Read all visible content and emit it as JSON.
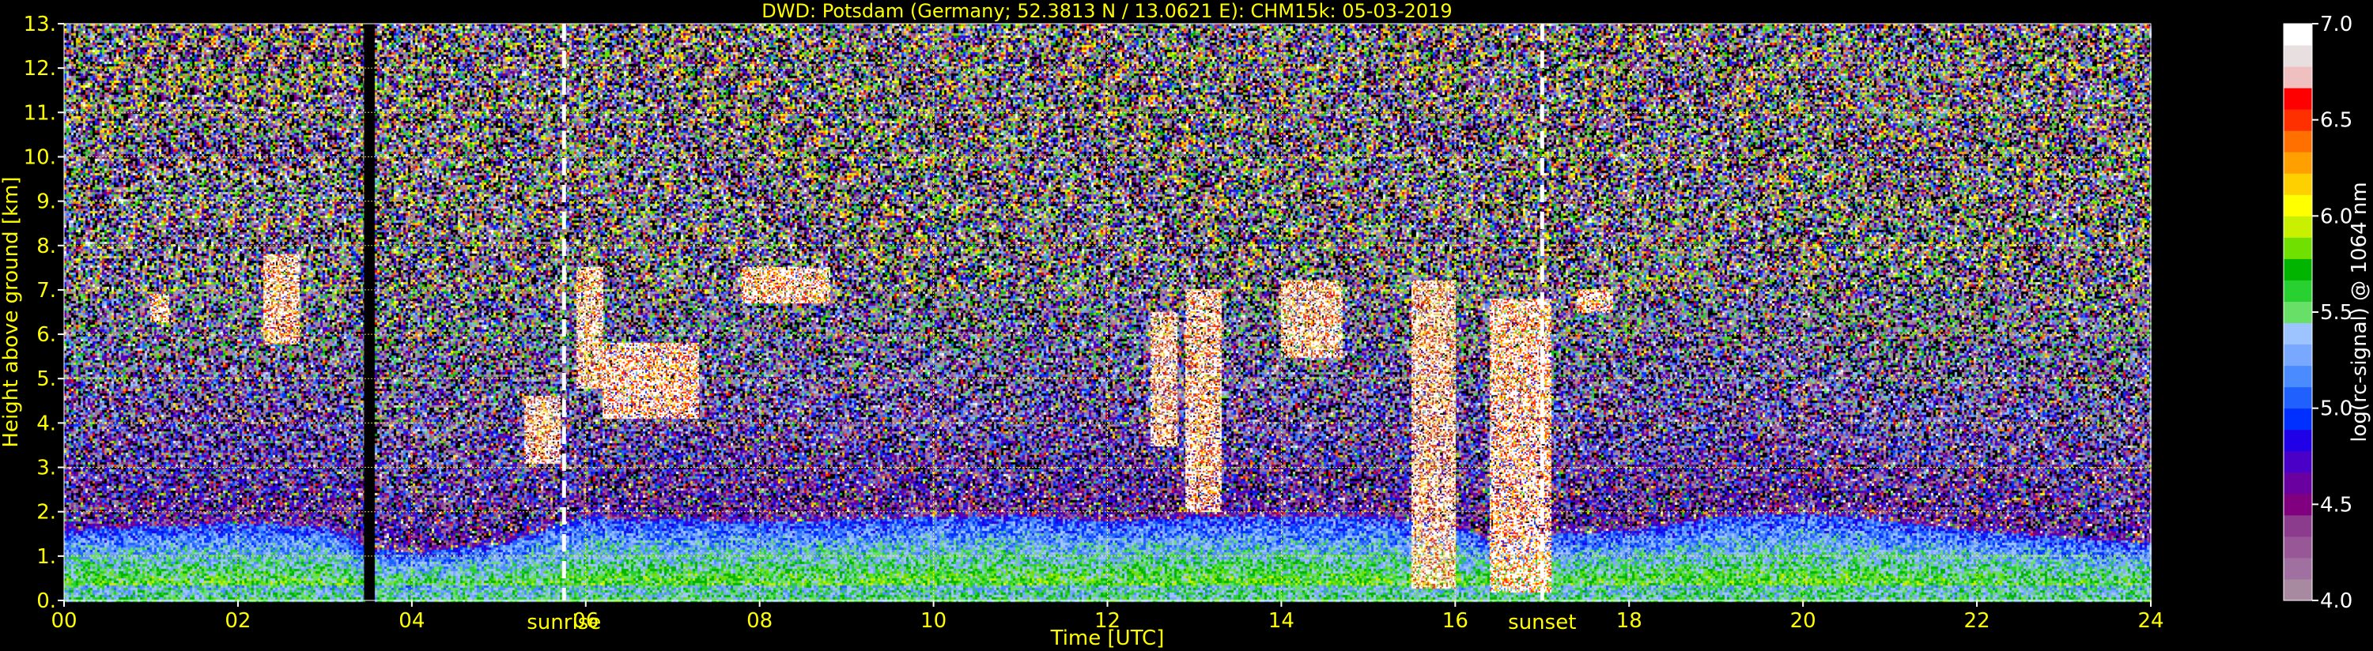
{
  "header": {
    "title": "DWD: Potsdam (Germany; 52.3813 N / 13.0621 E):    CHM15k: 05-03-2019"
  },
  "chart_data": {
    "type": "heatmap",
    "title": "DWD: Potsdam (Germany; 52.3813 N / 13.0621 E):    CHM15k: 05-03-2019",
    "xlabel": "Time [UTC]",
    "ylabel": "Height above ground [km]",
    "xlim": [
      0,
      24
    ],
    "ylim": [
      0,
      13
    ],
    "x_ticks": [
      "00",
      "02",
      "04",
      "06",
      "08",
      "10",
      "12",
      "14",
      "16",
      "18",
      "20",
      "22",
      "24"
    ],
    "x_tick_values": [
      0,
      2,
      4,
      6,
      8,
      10,
      12,
      14,
      16,
      18,
      20,
      22,
      24
    ],
    "y_ticks": [
      "0.",
      "1.",
      "2.",
      "3.",
      "4.",
      "5.",
      "6.",
      "7.",
      "8.",
      "9.",
      "10.",
      "11.",
      "12.",
      "13."
    ],
    "y_tick_values": [
      0,
      1,
      2,
      3,
      4,
      5,
      6,
      7,
      8,
      9,
      10,
      11,
      12,
      13
    ],
    "grid": true,
    "grid_color": "#ffff00",
    "events": [
      {
        "label": "sunrise",
        "time": 5.75
      },
      {
        "label": "sunset",
        "time": 17.0
      }
    ],
    "data_gap": {
      "start": 3.45,
      "end": 3.55
    },
    "boundary_layer_top_km": [
      [
        0,
        1.6
      ],
      [
        1,
        1.7
      ],
      [
        2,
        1.75
      ],
      [
        3,
        1.7
      ],
      [
        3.5,
        1.2
      ],
      [
        4,
        1.1
      ],
      [
        5,
        1.3
      ],
      [
        5.5,
        1.6
      ],
      [
        6,
        1.9
      ],
      [
        8,
        1.8
      ],
      [
        10,
        1.9
      ],
      [
        11,
        1.95
      ],
      [
        12,
        1.8
      ],
      [
        13,
        1.9
      ],
      [
        14,
        1.9
      ],
      [
        15,
        1.9
      ],
      [
        16,
        1.7
      ],
      [
        16.5,
        1.3
      ],
      [
        17,
        1.5
      ],
      [
        18,
        1.6
      ],
      [
        19,
        1.9
      ],
      [
        20,
        2.0
      ],
      [
        21,
        1.8
      ],
      [
        22,
        1.6
      ],
      [
        24,
        1.3
      ]
    ],
    "clouds": [
      {
        "t0": 1.0,
        "t1": 1.2,
        "h0": 6.3,
        "h1": 6.9
      },
      {
        "t0": 2.3,
        "t1": 2.7,
        "h0": 5.8,
        "h1": 7.8
      },
      {
        "t0": 5.3,
        "t1": 5.7,
        "h0": 3.1,
        "h1": 4.6
      },
      {
        "t0": 5.9,
        "t1": 6.2,
        "h0": 4.8,
        "h1": 7.5
      },
      {
        "t0": 6.2,
        "t1": 7.3,
        "h0": 4.1,
        "h1": 5.8
      },
      {
        "t0": 7.8,
        "t1": 8.8,
        "h0": 6.7,
        "h1": 7.5
      },
      {
        "t0": 12.5,
        "t1": 12.8,
        "h0": 3.5,
        "h1": 6.5
      },
      {
        "t0": 12.9,
        "t1": 13.3,
        "h0": 2.0,
        "h1": 7.0
      },
      {
        "t0": 14.0,
        "t1": 14.7,
        "h0": 5.5,
        "h1": 7.2
      },
      {
        "t0": 15.5,
        "t1": 16.0,
        "h0": 0.3,
        "h1": 7.2
      },
      {
        "t0": 16.4,
        "t1": 17.1,
        "h0": 0.2,
        "h1": 6.8
      },
      {
        "t0": 17.4,
        "t1": 17.8,
        "h0": 6.5,
        "h1": 7.0
      }
    ],
    "colorbar": {
      "label": "log(rc-signal) @ 1064 nm",
      "min": 4.0,
      "max": 7.0,
      "ticks": [
        "4.0",
        "4.5",
        "5.0",
        "5.5",
        "6.0",
        "6.5",
        "7.0"
      ],
      "tick_values": [
        4.0,
        4.5,
        5.0,
        5.5,
        6.0,
        6.5,
        7.0
      ],
      "colors": [
        "#a88aa0",
        "#a070a0",
        "#985898",
        "#8c3c8c",
        "#800080",
        "#6a00a0",
        "#4b00c8",
        "#2000e6",
        "#0030ff",
        "#2060ff",
        "#4a8cff",
        "#78a8ff",
        "#9ec4ff",
        "#68e068",
        "#28d030",
        "#00b400",
        "#70e000",
        "#c8f000",
        "#ffff00",
        "#ffd000",
        "#ffa000",
        "#ff7000",
        "#ff3000",
        "#ff0000",
        "#f0c0c0",
        "#e8e0e0",
        "#ffffff"
      ]
    }
  }
}
